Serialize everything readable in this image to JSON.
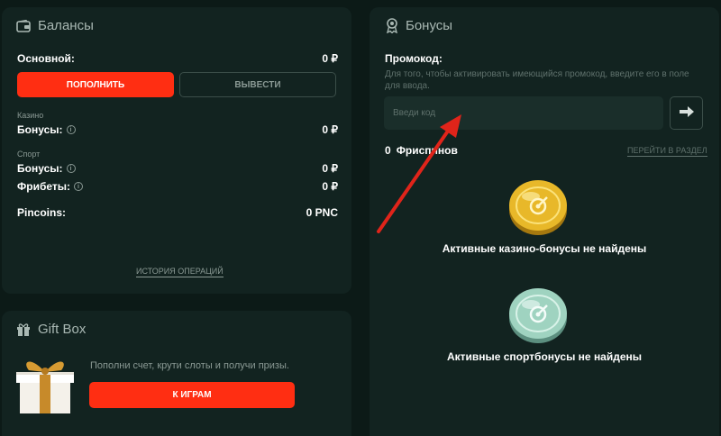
{
  "balances": {
    "title": "Балансы",
    "main_label": "Основной:",
    "main_value": "0 ₽",
    "deposit_label": "ПОПОЛНИТЬ",
    "withdraw_label": "ВЫВЕСТИ",
    "casino_section": "Казино",
    "casino_bonus_label": "Бонусы:",
    "casino_bonus_value": "0 ₽",
    "sport_section": "Спорт",
    "sport_bonus_label": "Бонусы:",
    "sport_bonus_value": "0 ₽",
    "freebets_label": "Фрибеты:",
    "freebets_value": "0 ₽",
    "pincoins_label": "Pincoins:",
    "pincoins_value": "0 PNC",
    "history_link": "ИСТОРИЯ ОПЕРАЦИЙ"
  },
  "giftbox": {
    "title": "Gift Box",
    "description": "Пополни счет, крути слоты и получи призы.",
    "play_label": "К ИГРАМ"
  },
  "bonuses": {
    "title": "Бонусы",
    "promo_label": "Промокод:",
    "promo_hint": "Для того, чтобы активировать имеющийся промокод, введите его в поле для ввода.",
    "promo_placeholder": "Введи код",
    "freespins_count": "0",
    "freespins_label": "Фриспинов",
    "go_section_link": "ПЕРЕЙТИ В РАЗДЕЛ",
    "casino_empty": "Активные казино-бонусы не найдены",
    "sport_empty": "Активные спортбонусы не найдены"
  },
  "colors": {
    "accent": "#ff2e12",
    "panel": "#122320",
    "background": "#0c1a17",
    "gold_coin": "#e8b829",
    "silver_coin": "#9fd3c0"
  }
}
